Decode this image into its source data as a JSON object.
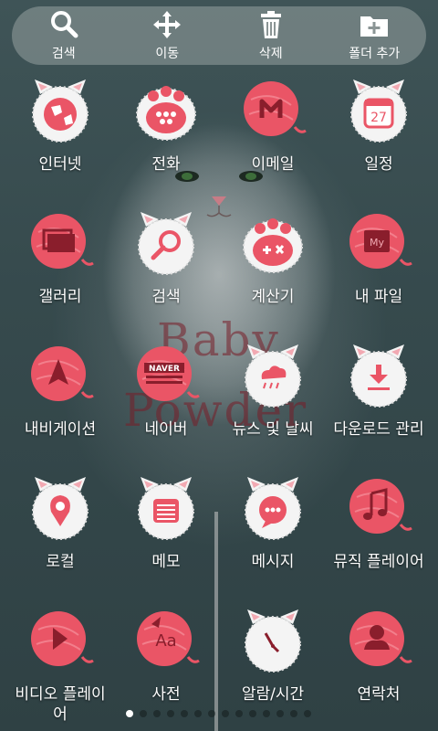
{
  "colors": {
    "accent": "#ea5566",
    "fur": "#f4f4f4",
    "toolbar": "#9aa2a2"
  },
  "toolbar": {
    "items": [
      {
        "label": "검색",
        "icon": "search-icon"
      },
      {
        "label": "이동",
        "icon": "move-icon"
      },
      {
        "label": "삭제",
        "icon": "trash-icon"
      },
      {
        "label": "폴더 추가",
        "icon": "folder-add-icon"
      }
    ]
  },
  "wallpaper": {
    "line1": "Baby",
    "line2": "Powder"
  },
  "apps": [
    {
      "label": "인터넷",
      "style": "cat",
      "icon": "globe-icon"
    },
    {
      "label": "전화",
      "style": "paw",
      "icon": "phone-paw-icon"
    },
    {
      "label": "이메일",
      "style": "ball",
      "icon": "mail-icon"
    },
    {
      "label": "일정",
      "style": "cat",
      "icon": "calendar-icon",
      "badge": "27"
    },
    {
      "label": "갤러리",
      "style": "ball",
      "icon": "gallery-icon"
    },
    {
      "label": "검색",
      "style": "cat",
      "icon": "search-icon"
    },
    {
      "label": "계산기",
      "style": "paw",
      "icon": "calculator-icon"
    },
    {
      "label": "내 파일",
      "style": "ball",
      "icon": "my-files-icon",
      "badge": "My"
    },
    {
      "label": "내비게이션",
      "style": "ball",
      "icon": "navigation-icon"
    },
    {
      "label": "네이버",
      "style": "ball",
      "icon": "naver-icon",
      "badge": "NAVER"
    },
    {
      "label": "뉴스 및 날씨",
      "style": "cat",
      "icon": "weather-icon"
    },
    {
      "label": "다운로드 관리",
      "style": "cat",
      "icon": "download-icon"
    },
    {
      "label": "로컬",
      "style": "cat",
      "icon": "location-pin-icon"
    },
    {
      "label": "메모",
      "style": "cat",
      "icon": "memo-icon"
    },
    {
      "label": "메시지",
      "style": "cat",
      "icon": "message-icon"
    },
    {
      "label": "뮤직 플레이어",
      "style": "ball",
      "icon": "music-icon"
    },
    {
      "label": "비디오 플레이어",
      "style": "ball",
      "icon": "video-play-icon"
    },
    {
      "label": "사전",
      "style": "ball",
      "icon": "dictionary-icon",
      "badge": "Aa"
    },
    {
      "label": "알람/시간",
      "style": "cat",
      "icon": "clock-icon"
    },
    {
      "label": "연락처",
      "style": "ball",
      "icon": "contact-icon"
    }
  ],
  "pager": {
    "total": 14,
    "current": 1
  }
}
